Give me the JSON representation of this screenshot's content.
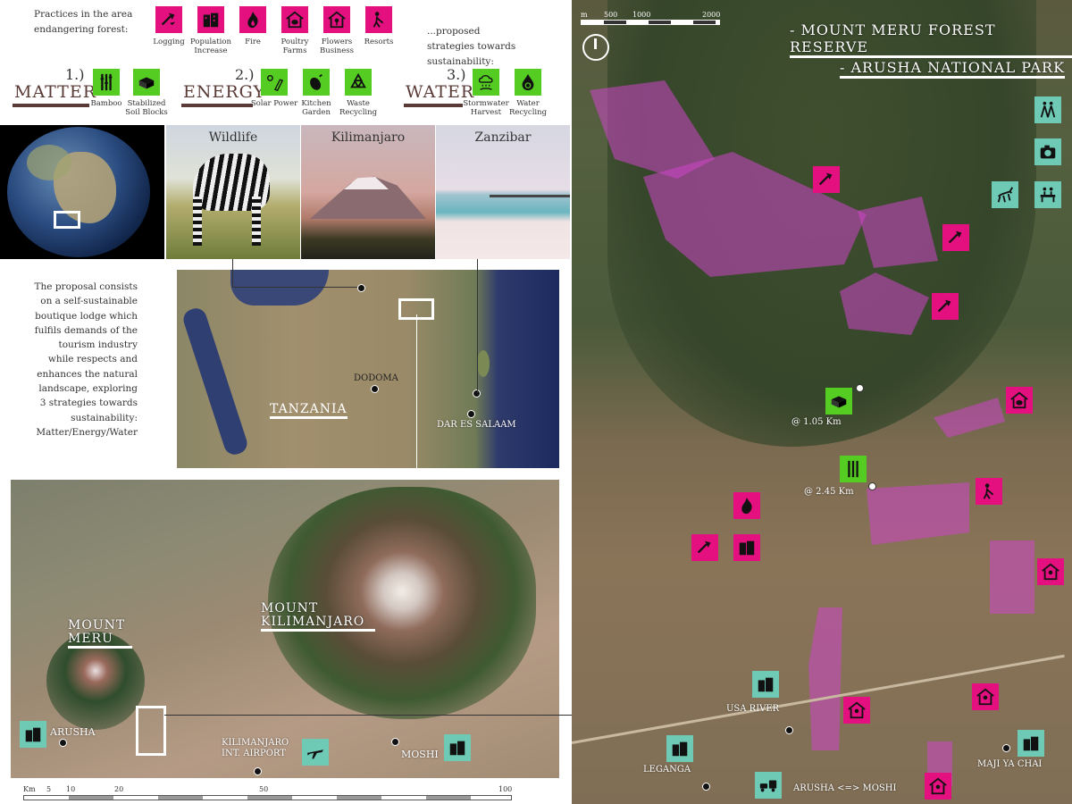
{
  "colors": {
    "magenta": "#e4107f",
    "green": "#55cc22",
    "teal": "#6ec9b5",
    "heading": "#5a3a36",
    "zone": "#cd46c8"
  },
  "practices": {
    "intro": "Practices in the area endangering forest:",
    "items": [
      {
        "label": "Logging",
        "icon": "axe-icon"
      },
      {
        "label": "Population Increase",
        "icon": "buildings-icon"
      },
      {
        "label": "Fire",
        "icon": "fire-icon"
      },
      {
        "label": "Poultry Farms",
        "icon": "chicken-house-icon"
      },
      {
        "label": "Flowers Business",
        "icon": "flower-house-icon"
      },
      {
        "label": "Resorts",
        "icon": "golfer-icon"
      }
    ],
    "outro": "...proposed strategies towards sustainability:"
  },
  "strategies": [
    {
      "number": "1.)",
      "title": "MATTER",
      "items": [
        {
          "label": "Bamboo",
          "icon": "bamboo-icon"
        },
        {
          "label": "Stabilized Soil Blocks",
          "icon": "soil-blocks-icon"
        }
      ]
    },
    {
      "number": "2.)",
      "title": "ENERGY",
      "items": [
        {
          "label": "Solar Power",
          "icon": "solar-panel-icon"
        },
        {
          "label": "Kitchen Garden",
          "icon": "eggplant-icon"
        },
        {
          "label": "Waste Recycling",
          "icon": "recycle-icon"
        }
      ]
    },
    {
      "number": "3.)",
      "title": "WATER",
      "items": [
        {
          "label": "Stormwater Harvest",
          "icon": "rain-cloud-icon"
        },
        {
          "label": "Water Recycling",
          "icon": "water-drop-icon"
        }
      ]
    }
  ],
  "photos": [
    {
      "label": "Wildlife"
    },
    {
      "label": "Kilimanjaro"
    },
    {
      "label": "Zanzibar"
    }
  ],
  "description": "The proposal consists on a self-sustainable boutique lodge which fulfils demands of the tourism industry while respects and enhances the natural landscape, exploring 3 strategies towards sustainability: Matter/Energy/Water",
  "tanzania_map": {
    "country": "TANZANIA",
    "cities": [
      "DODOMA",
      "DAR ES SALAAM"
    ]
  },
  "region_map": {
    "mount_meru": "MOUNT MERU",
    "kilimanjaro": "MOUNT KILIMANJARO",
    "places": [
      "ARUSHA",
      "KILIMANJARO INT. AIRPORT",
      "MOSHI"
    ],
    "scale": {
      "unit": "Km",
      "ticks": [
        "5",
        "10",
        "20",
        "50",
        "100"
      ]
    }
  },
  "detail_map": {
    "title1": "- MOUNT MERU FOREST RESERVE",
    "title2": "- ARUSHA NATIONAL PARK",
    "scale": {
      "unit": "m",
      "ticks": [
        "500",
        "1000",
        "2000"
      ]
    },
    "distance1": "@ 1.05 Km",
    "distance2": "@ 2.45 Km",
    "places": [
      "USA RIVER",
      "LEGANGA",
      "MAJI YA CHAI",
      "ARUSHA <=> MOSHI"
    ]
  }
}
